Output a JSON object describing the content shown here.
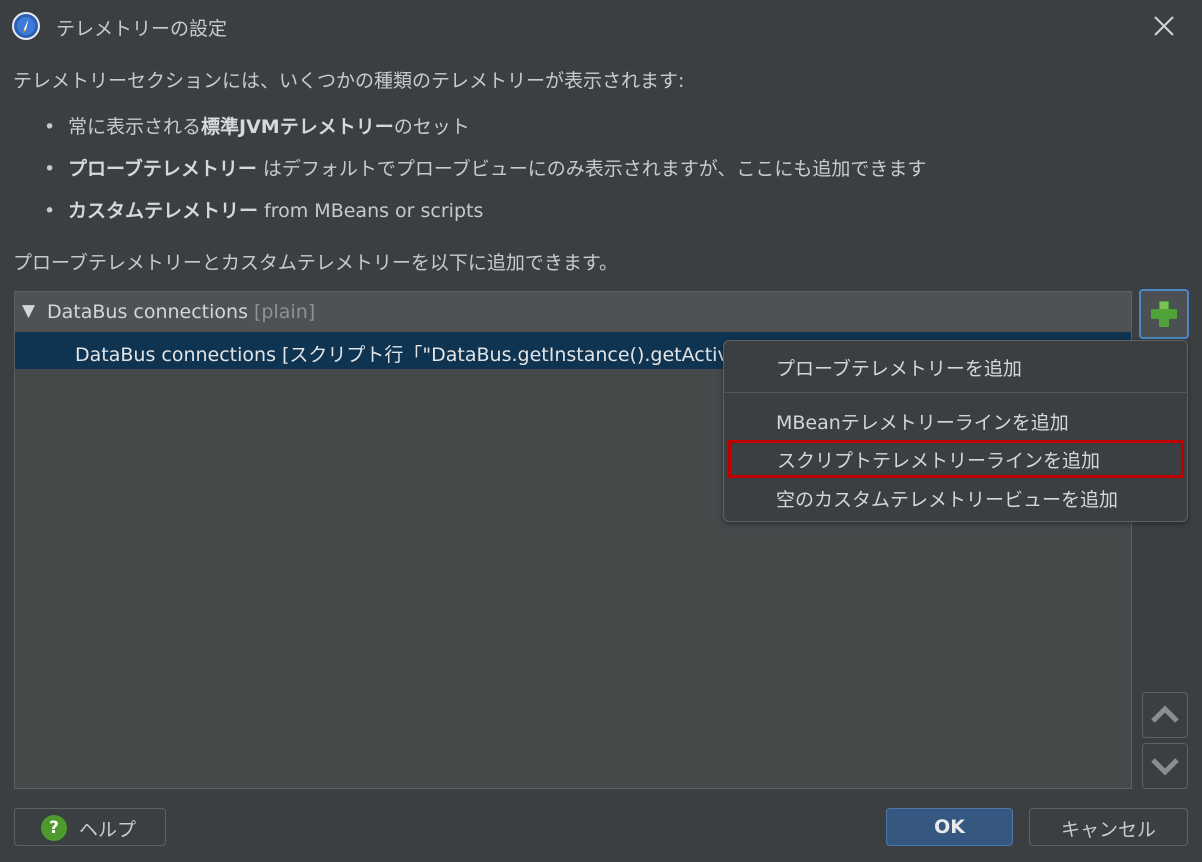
{
  "window": {
    "title": "テレメトリーの設定",
    "close_icon": "close-icon",
    "app_icon": "compass-icon"
  },
  "content": {
    "intro": "テレメトリーセクションには、いくつかの種類のテレメトリーが表示されます:",
    "bullets": [
      {
        "pre": "常に表示される",
        "bold": "標準JVMテレメトリー",
        "post": "のセット"
      },
      {
        "pre": "",
        "bold": "プローブテレメトリー",
        "post": " はデフォルトでプローブビューにのみ表示されますが、ここにも追加できます"
      },
      {
        "pre": "",
        "bold": "カスタムテレメトリー",
        "post": " from MBeans or scripts"
      }
    ],
    "note": "プローブテレメトリーとカスタムテレメトリーを以下に追加できます。"
  },
  "tree": {
    "group_label": "DataBus connections",
    "group_tag": "[plain]",
    "expanded_icon": "triangle-down-icon",
    "rows": [
      {
        "label": "DataBus connections [スクリプト行「\"DataBus.getInstance().getActive"
      }
    ]
  },
  "side_buttons": {
    "add_icon": "plus-icon",
    "up_icon": "chevron-up-icon",
    "down_icon": "chevron-down-icon"
  },
  "menu": {
    "items": [
      "プローブテレメトリーを追加",
      "MBeanテレメトリーラインを追加",
      "スクリプトテレメトリーラインを追加",
      "空のカスタムテレメトリービューを追加"
    ]
  },
  "footer": {
    "help_label": "ヘルプ",
    "help_icon_glyph": "?",
    "ok_label": "OK",
    "cancel_label": "キャンセル"
  },
  "colors": {
    "background": "#3c3f41",
    "selection": "#0f3451",
    "accent": "#4a88c7",
    "highlight_border": "#c00000",
    "plus_green": "#4fa33a"
  }
}
